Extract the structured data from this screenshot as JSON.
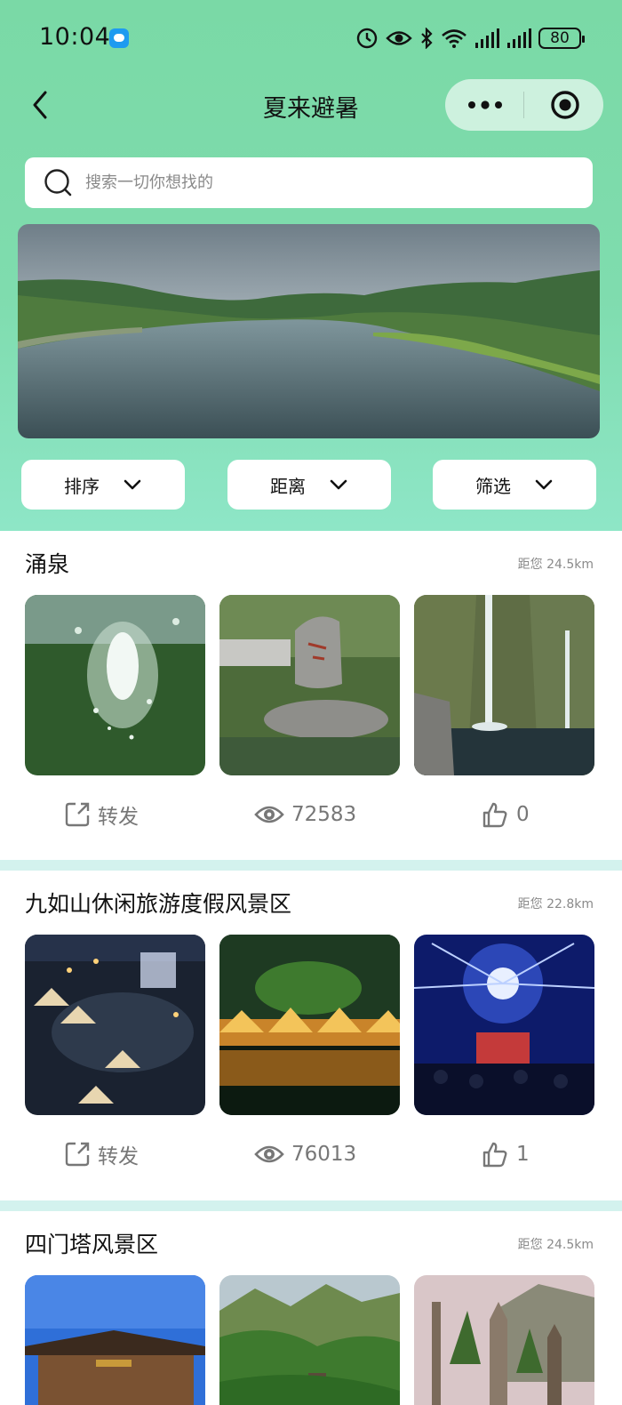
{
  "status_bar": {
    "time": "10:04",
    "battery": "80"
  },
  "nav": {
    "title": "夏来避暑"
  },
  "search": {
    "placeholder": "搜索一切你想找的"
  },
  "filters": [
    {
      "label": "排序"
    },
    {
      "label": "距离"
    },
    {
      "label": "筛选"
    }
  ],
  "sections": [
    {
      "title": "涌泉",
      "distance": "距您 24.5km",
      "share_label": "转发",
      "views": "72583",
      "likes": "0"
    },
    {
      "title": "九如山休闲旅游度假风景区",
      "distance": "距您 22.8km",
      "share_label": "转发",
      "views": "76013",
      "likes": "1"
    },
    {
      "title": "四门塔风景区",
      "distance": "距您 24.5km"
    }
  ],
  "colors": {
    "header_green": "#7ad9a6",
    "separator": "#d3f2ee",
    "muted_text": "#8a8a8a"
  },
  "icons": [
    "back-icon",
    "more-icon",
    "target-icon",
    "search-icon",
    "chevron-down-icon",
    "share-icon",
    "eye-icon",
    "thumb-up-icon"
  ]
}
